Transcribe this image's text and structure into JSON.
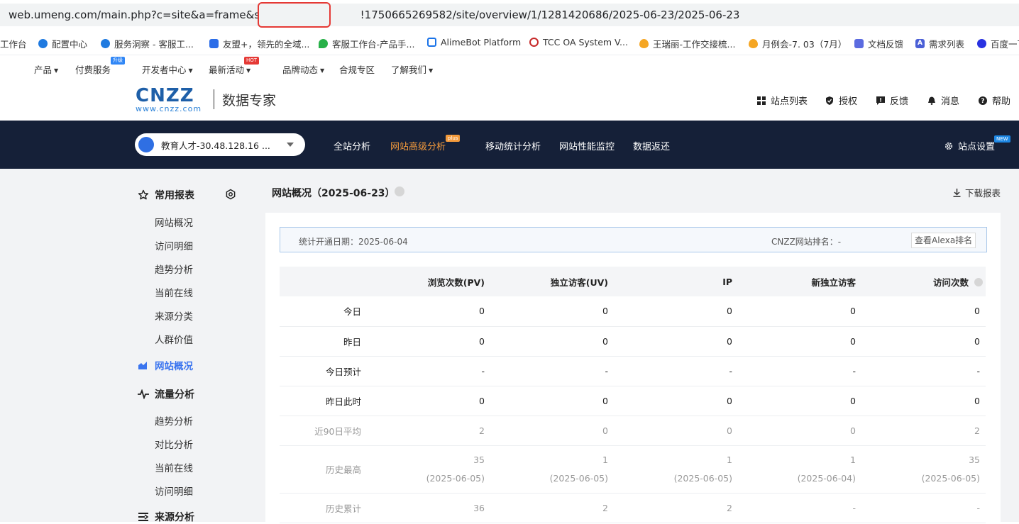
{
  "browser": {
    "url_prefix": "web.umeng.com/main.php?c=site&a=frame&siteid=",
    "url_suffix": "!1750665269582/site/overview/1/1281420686/2025-06-23/2025-06-23"
  },
  "bookmarks": [
    {
      "label": "工作台",
      "icon": "workbench-icon",
      "color": "#ffffff"
    },
    {
      "label": "配置中心",
      "icon": "config-center-icon",
      "color": "#1f7ae0"
    },
    {
      "label": "服务洞察 - 客服工...",
      "icon": "insight-icon",
      "color": "#1f7ae0"
    },
    {
      "label": "友盟+，领先的全域...",
      "icon": "umeng-icon",
      "color": "#2b6de8"
    },
    {
      "label": "客服工作台-产品手...",
      "icon": "leaf-icon",
      "color": "#27b148"
    },
    {
      "label": "AlimeBot Platform",
      "icon": "cube-icon",
      "color": "#1a73e8"
    },
    {
      "label": "TCC OA System V...",
      "icon": "globe-icon",
      "color": "#c62828"
    },
    {
      "label": "王瑞丽-工作交接梳...",
      "icon": "flame-icon",
      "color": "#f5a623"
    },
    {
      "label": "月例会-7. 03（7月）",
      "icon": "flame-icon",
      "color": "#f5a623"
    },
    {
      "label": "文档反馈",
      "icon": "doc-icon",
      "color": "#5b6be0"
    },
    {
      "label": "需求列表",
      "icon": "letter-a-icon",
      "color": "#4a5fd6"
    },
    {
      "label": "百度一下",
      "icon": "paw-icon",
      "color": "#2932e1"
    }
  ],
  "topmenu": [
    {
      "label": "产品",
      "dropdown": true
    },
    {
      "label": "付费服务",
      "dropdown": false,
      "tag": "升级",
      "tag_color": "#2f86f6"
    },
    {
      "label": "开发者中心",
      "dropdown": true
    },
    {
      "label": "最新活动",
      "dropdown": true,
      "tag": "HOT",
      "tag_color": "#e53935"
    },
    {
      "label": "品牌动态",
      "dropdown": true
    },
    {
      "label": "合规专区",
      "dropdown": false
    },
    {
      "label": "了解我们",
      "dropdown": true
    }
  ],
  "header": {
    "logo_main": "CNZZ",
    "logo_sub": "www.cnzz.com",
    "logo_title": "数据专家",
    "links": [
      {
        "label": "站点列表",
        "icon": "grid-icon"
      },
      {
        "label": "授权",
        "icon": "shield-icon"
      },
      {
        "label": "反馈",
        "icon": "feedback-icon"
      },
      {
        "label": "消息",
        "icon": "bell-icon"
      },
      {
        "label": "帮助",
        "icon": "help-icon"
      }
    ]
  },
  "nav": {
    "site_name": "教育人才-30.48.128.16 ...",
    "tabs": [
      {
        "label": "全站分析",
        "active": false
      },
      {
        "label": "网站高级分析",
        "active": true,
        "badge": "plus"
      },
      {
        "label": "移动统计分析",
        "active": false
      },
      {
        "label": "网站性能监控",
        "active": false
      },
      {
        "label": "数据返还",
        "active": false
      }
    ],
    "settings_label": "站点设置",
    "settings_badge": "NEW"
  },
  "sidebar": {
    "common_title": "常用报表",
    "common_items": [
      "网站概况",
      "访问明细",
      "趋势分析",
      "当前在线",
      "来源分类",
      "人群价值"
    ],
    "overview_label": "网站概况",
    "traffic_title": "流量分析",
    "traffic_items": [
      "趋势分析",
      "对比分析",
      "当前在线",
      "访问明细"
    ],
    "source_title": "来源分析"
  },
  "main": {
    "title": "网站概况（2025-06-23）",
    "download_label": "下载报表",
    "open_date": "统计开通日期：2025-06-04",
    "rank": "CNZZ网站排名：-",
    "alexa_button": "查看Alexa排名"
  },
  "stats": {
    "columns": [
      "浏览次数(PV)",
      "独立访客(UV)",
      "IP",
      "新独立访客",
      "访问次数"
    ],
    "rows": [
      {
        "label": "今日",
        "values": [
          "0",
          "0",
          "0",
          "0",
          "0"
        ],
        "muted": false
      },
      {
        "label": "昨日",
        "values": [
          "0",
          "0",
          "0",
          "0",
          "0"
        ],
        "muted": false
      },
      {
        "label": "今日预计",
        "values": [
          "-",
          "-",
          "-",
          "-",
          "-"
        ],
        "muted": false
      },
      {
        "label": "昨日此时",
        "values": [
          "0",
          "0",
          "0",
          "0",
          "0"
        ],
        "muted": false
      },
      {
        "label": "近90日平均",
        "values": [
          "2",
          "0",
          "0",
          "0",
          "2"
        ],
        "muted": true
      },
      {
        "label": "历史最高",
        "values": [
          "35",
          "1",
          "1",
          "1",
          "35"
        ],
        "dates": [
          "(2025-06-05)",
          "(2025-06-05)",
          "(2025-06-05)",
          "(2025-06-04)",
          "(2025-06-05)"
        ],
        "muted": true
      },
      {
        "label": "历史累计",
        "values": [
          "36",
          "2",
          "2",
          "-",
          "-"
        ],
        "muted": true
      }
    ]
  }
}
